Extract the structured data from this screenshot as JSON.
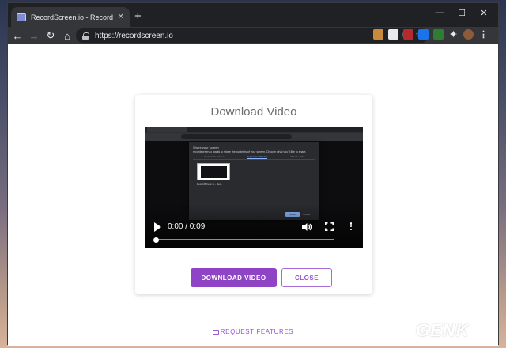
{
  "browser": {
    "tab_title": "RecordScreen.io - Record your sc",
    "new_tab": "+",
    "window": {
      "minimize": "—",
      "maximize": "☐",
      "close": "✕"
    },
    "url": "https://recordscreen.io"
  },
  "page": {
    "card_title": "Download Video",
    "video": {
      "time_display": "0:00 / 0:09",
      "progress": 0,
      "embedded_dialog": {
        "title": "Share your screen",
        "description": "recordscreen.io wants to share the contents of your screen. Choose what you'd like to share.",
        "tabs": [
          "Your Entire Screen",
          "Application Window",
          "Chrome Tab"
        ],
        "active_tab_index": 1,
        "window_label": "RecordScreen.io - Rec...",
        "share_label": "Share",
        "cancel_label": "Cancel"
      }
    },
    "download_button": "DOWNLOAD VIDEO",
    "close_button": "CLOSE",
    "request_link": "REQUEST FEATURES"
  },
  "watermark": {
    "text": "GEN",
    "accent": "K"
  },
  "colors": {
    "accent": "#8e44c4",
    "accent_text": "#9a55cf",
    "chrome_dark": "#202124"
  }
}
